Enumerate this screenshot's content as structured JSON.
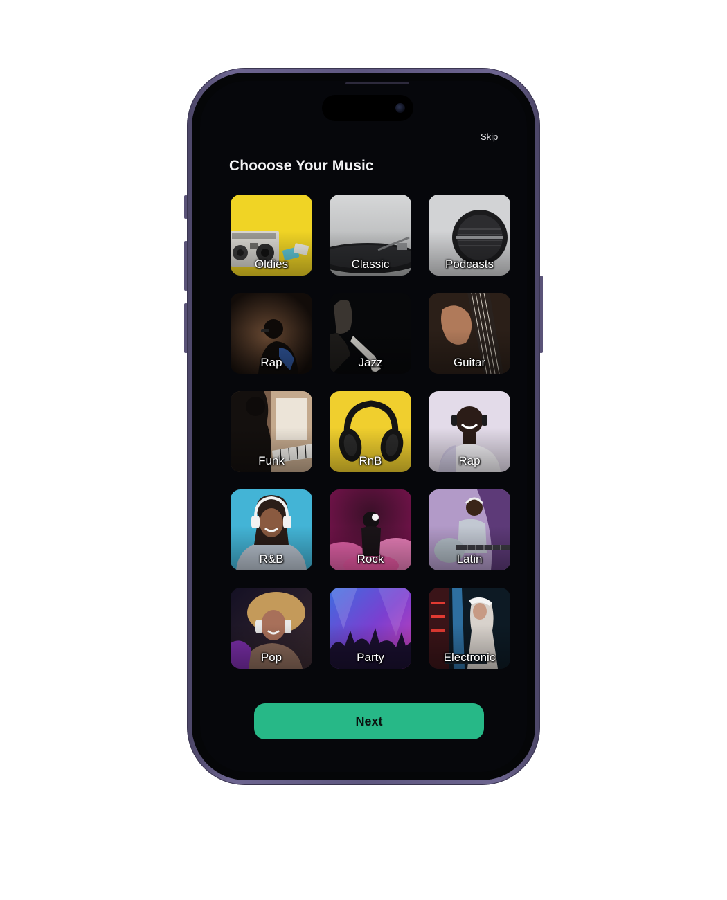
{
  "header": {
    "skip_label": "Skip",
    "title": "Chooose Your Music"
  },
  "genres": [
    {
      "label": "Oldies",
      "scene": "boombox on yellow"
    },
    {
      "label": "Classic",
      "scene": "vinyl turntable"
    },
    {
      "label": "Podcasts",
      "scene": "studio microphone"
    },
    {
      "label": "Rap",
      "scene": "rapper with microphone"
    },
    {
      "label": "Jazz",
      "scene": "saxophone player"
    },
    {
      "label": "Guitar",
      "scene": "hand on guitar strings"
    },
    {
      "label": "Funk",
      "scene": "piano player silhouette"
    },
    {
      "label": "RnB",
      "scene": "headphones on yellow"
    },
    {
      "label": "Rap",
      "scene": "smiling man with headphones"
    },
    {
      "label": "R&B",
      "scene": "girl with headphones on blue"
    },
    {
      "label": "Rock",
      "scene": "pink smoke singer"
    },
    {
      "label": "Latin",
      "scene": "woman with guitar"
    },
    {
      "label": "Pop",
      "scene": "curly hair woman with headphones"
    },
    {
      "label": "Party",
      "scene": "crowd at concert"
    },
    {
      "label": "Electronic",
      "scene": "DJ at neon club"
    }
  ],
  "footer": {
    "next_label": "Next"
  },
  "colors": {
    "screen_bg": "#06070b",
    "accent": "#27b887",
    "frame": "#5e5780"
  }
}
